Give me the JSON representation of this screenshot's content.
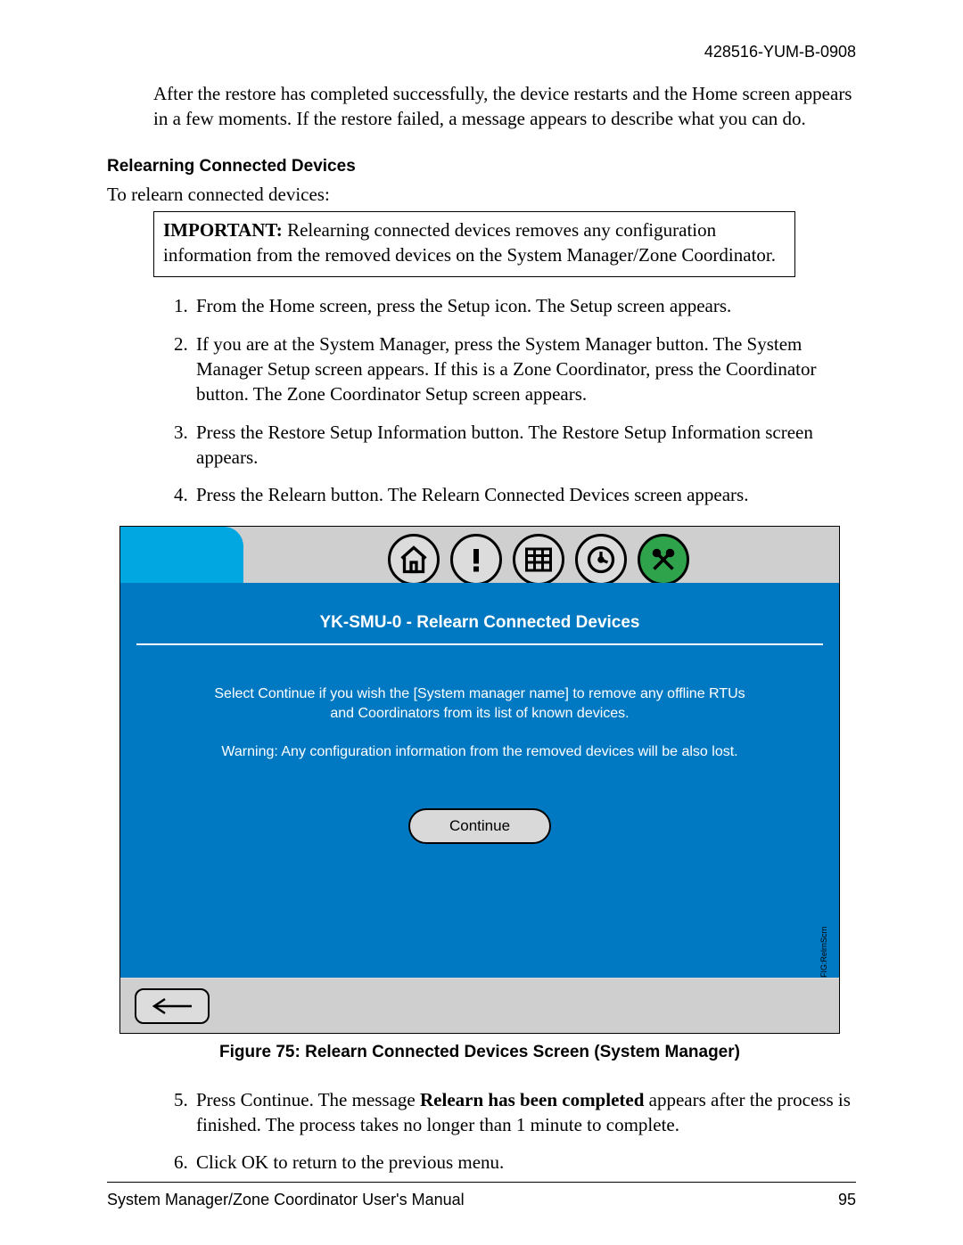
{
  "header": {
    "doc_id": "428516-YUM-B-0908"
  },
  "intro": "After the restore has completed successfully, the device restarts and the Home screen appears in a few moments. If the restore failed, a message appears to describe what you can do.",
  "section": {
    "title": "Relearning Connected Devices",
    "lead": "To relearn connected devices:"
  },
  "important": {
    "label": "IMPORTANT:",
    "text": "  Relearning connected devices removes any configuration information from the removed devices on the System Manager/Zone Coordinator."
  },
  "steps_a": [
    "From the Home screen, press the Setup icon. The Setup screen appears.",
    "If you are at the System Manager, press the System Manager button. The System Manager Setup screen appears. If this is a Zone Coordinator, press the Coordinator button. The Zone Coordinator Setup screen appears.",
    "Press the Restore Setup Information button. The Restore Setup Information screen appears.",
    "Press the Relearn button. The Relearn Connected Devices screen appears."
  ],
  "figure": {
    "title": "YK-SMU-0 - Relearn Connected Devices",
    "body_line1": "Select Continue if you wish the [System manager name] to remove any offline RTUs and Coordinators from its list of known devices.",
    "body_line2": "Warning:  Any configuration information from the removed devices will be also lost.",
    "continue": "Continue",
    "sidetext": "FIG:RelrnScrn",
    "caption": "Figure 75: Relearn Connected Devices Screen (System Manager)",
    "icons": [
      "home-icon",
      "alert-icon",
      "grid-icon",
      "clock-icon",
      "tools-icon"
    ]
  },
  "steps_b": {
    "s5_a": "Press Continue. The message ",
    "s5_bold": "Relearn has been completed",
    "s5_b": " appears after the process is finished. The process takes no longer than 1 minute to complete.",
    "s6": "Click OK to return to the previous menu."
  },
  "footer": {
    "left": "System Manager/Zone Coordinator User's Manual",
    "right": "95"
  }
}
